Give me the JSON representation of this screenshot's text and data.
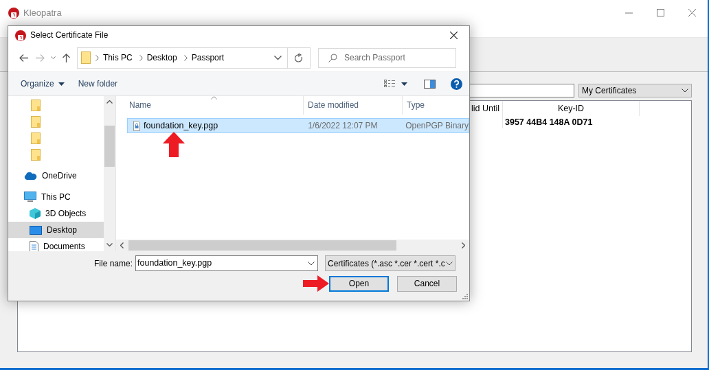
{
  "window": {
    "title": "Kleopatra"
  },
  "main": {
    "filter": {
      "value": "My Certificates"
    },
    "table": {
      "columns": [
        "lid Until",
        "Key-ID"
      ],
      "rows": [
        {
          "key_id": "3957 44B4 148A 0D71"
        }
      ]
    }
  },
  "dialog": {
    "title": "Select Certificate File",
    "address": {
      "crumbs": [
        "This PC",
        "Desktop",
        "Passport"
      ]
    },
    "search": {
      "placeholder": "Search Passport"
    },
    "toolbar": [
      {
        "label": "Organize",
        "dropdown": true
      },
      {
        "label": "New folder",
        "dropdown": false
      }
    ],
    "nav": [
      {
        "kind": "folder",
        "selected": false
      },
      {
        "kind": "folder",
        "selected": false
      },
      {
        "kind": "folder",
        "selected": false
      },
      {
        "kind": "folder",
        "selected": false
      },
      {
        "kind": "cloud",
        "label": "OneDrive",
        "selected": false
      },
      {
        "kind": "computer",
        "label": "This PC",
        "selected": false,
        "children": [
          {
            "kind": "cube",
            "label": "3D Objects",
            "selected": false
          },
          {
            "kind": "desktop",
            "label": "Desktop",
            "selected": true
          },
          {
            "kind": "document",
            "label": "Documents",
            "selected": false
          }
        ]
      }
    ],
    "files": {
      "columns": [
        "Name",
        "Date modified",
        "Type"
      ],
      "rows": [
        {
          "name": "foundation_key.pgp",
          "date": "1/6/2022 12:07 PM",
          "type": "OpenPGP Binary",
          "selected": true
        }
      ]
    },
    "file_name": {
      "label": "File name:",
      "value": "foundation_key.pgp"
    },
    "file_type": {
      "value": "Certificates (*.asc *.cer *.cert *.c"
    },
    "buttons": [
      {
        "label": "Open",
        "default": true
      },
      {
        "label": "Cancel",
        "default": false
      }
    ],
    "pointer_arrows": [
      {
        "kind": "up"
      },
      {
        "kind": "right"
      }
    ]
  }
}
